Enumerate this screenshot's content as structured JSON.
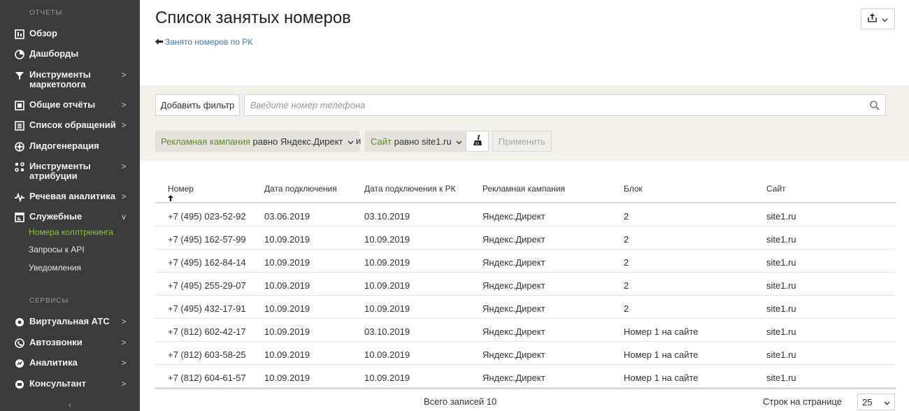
{
  "sidebar": {
    "section_reports": "ОТЧЕТЫ",
    "section_services": "СЕРВИСЫ",
    "items": [
      {
        "label": "Обзор",
        "icon": "overview-icon",
        "arrow": ""
      },
      {
        "label": "Дашборды",
        "icon": "dashboard-icon",
        "arrow": ""
      },
      {
        "label": "Инструменты маркетолога",
        "icon": "filter-funnel-icon",
        "arrow": ">"
      },
      {
        "label": "Общие отчёты",
        "icon": "reports-icon",
        "arrow": ">"
      },
      {
        "label": "Список обращений",
        "icon": "list-icon",
        "arrow": ">"
      },
      {
        "label": "Лидогенерация",
        "icon": "leadgen-icon",
        "arrow": ""
      },
      {
        "label": "Инструменты атрибуции",
        "icon": "attribution-icon",
        "arrow": ">"
      },
      {
        "label": "Речевая аналитика",
        "icon": "speech-wave-icon",
        "arrow": ">"
      },
      {
        "label": "Служебные",
        "icon": "service-icon",
        "arrow": "v"
      }
    ],
    "subitems": [
      "Номера коллтрекинга",
      "Запросы к API",
      "Уведомления"
    ],
    "services": [
      {
        "label": "Виртуальная АТС",
        "icon": "pbx-icon",
        "arrow": ">"
      },
      {
        "label": "Автозвонки",
        "icon": "autocall-icon",
        "arrow": ">"
      },
      {
        "label": "Аналитика",
        "icon": "analytics-icon",
        "arrow": ">"
      },
      {
        "label": "Консультант",
        "icon": "consultant-icon",
        "arrow": ">"
      }
    ],
    "collapse": "‹"
  },
  "header": {
    "title": "Список занятых номеров",
    "back_link": "Занято номеров по РК",
    "back_arrow": "🡐"
  },
  "filters": {
    "add_filter_label": "Добавить фильтр",
    "search_placeholder": "Введите номер телефона",
    "chip1_field": "Рекламная кампания",
    "chip1_rest": " равно Яндекс.Директ",
    "and_label": "и",
    "chip2_field": "Сайт",
    "chip2_rest": " равно site1.ru",
    "apply_label": "Применить"
  },
  "table": {
    "columns": [
      "Номер",
      "Дата подключения",
      "Дата подключения к РК",
      "Рекламная кампания",
      "Блок",
      "Сайт"
    ],
    "sort_column": "Номер",
    "rows": [
      [
        "+7 (495) 023-52-92",
        "03.06.2019",
        "03.10.2019",
        "Яндекс.Директ",
        "2",
        "site1.ru"
      ],
      [
        "+7 (495) 162-57-99",
        "10.09.2019",
        "10.09.2019",
        "Яндекс.Директ",
        "2",
        "site1.ru"
      ],
      [
        "+7 (495) 162-84-14",
        "10.09.2019",
        "10.09.2019",
        "Яндекс.Директ",
        "2",
        "site1.ru"
      ],
      [
        "+7 (495) 255-29-07",
        "10.09.2019",
        "10.09.2019",
        "Яндекс.Директ",
        "2",
        "site1.ru"
      ],
      [
        "+7 (495) 432-17-91",
        "10.09.2019",
        "10.09.2019",
        "Яндекс.Директ",
        "2",
        "site1.ru"
      ],
      [
        "+7 (812) 602-42-17",
        "10.09.2019",
        "03.10.2019",
        "Яндекс.Директ",
        "Номер 1 на сайте",
        "site1.ru"
      ],
      [
        "+7 (812) 603-58-25",
        "10.09.2019",
        "10.09.2019",
        "Яндекс.Директ",
        "Номер 1 на сайте",
        "site1.ru"
      ],
      [
        "+7 (812) 604-61-57",
        "10.09.2019",
        "10.09.2019",
        "Яндекс.Директ",
        "Номер 1 на сайте",
        "site1.ru"
      ]
    ]
  },
  "footer": {
    "total": "Всего записей 10",
    "rows_per_page_label": "Строк на странице",
    "rows_per_page_value": "25"
  },
  "colors": {
    "sidebar_bg": "#3b3b3b",
    "accent_green": "#8cc63f",
    "link_blue": "#3d7ab8",
    "filter_panel_bg": "#f3f1ea"
  }
}
